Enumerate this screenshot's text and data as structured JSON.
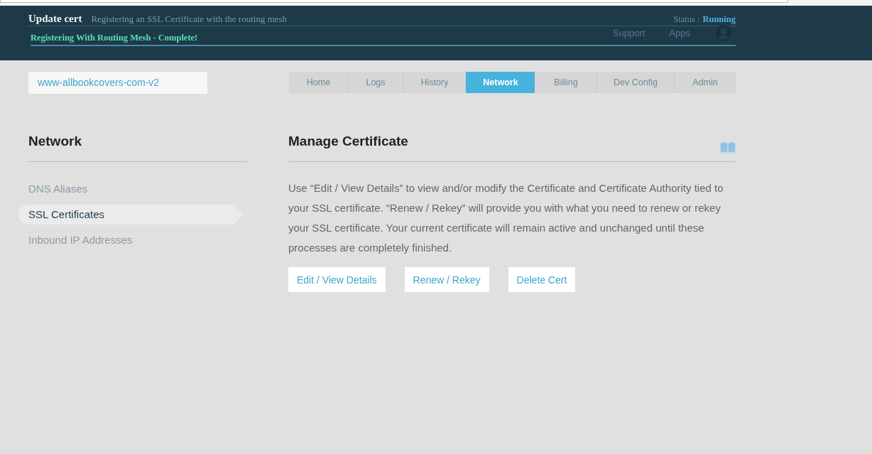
{
  "header": {
    "title": "Update cert",
    "subtitle": "Registering an SSL Certificate with the routing mesh",
    "status_label": "Status :",
    "status_value": "Running",
    "progress_message": "Registering With Routing Mesh - Complete!",
    "nav_links": [
      "Support",
      "Apps"
    ]
  },
  "app_name": "www-allbookcovers-com-v2",
  "tabs": [
    {
      "label": "Home",
      "selected": false
    },
    {
      "label": "Logs",
      "selected": false
    },
    {
      "label": "History",
      "selected": false
    },
    {
      "label": "Network",
      "selected": true
    },
    {
      "label": "Billing",
      "selected": false
    },
    {
      "label": "Dev Config",
      "selected": false
    },
    {
      "label": "Admin",
      "selected": false
    }
  ],
  "sidebar": {
    "title": "Network",
    "items": [
      {
        "label": "DNS Aliases",
        "selected": false
      },
      {
        "label": "SSL Certificates",
        "selected": true
      },
      {
        "label": "Inbound IP Addresses",
        "selected": false
      }
    ]
  },
  "main": {
    "title": "Manage Certificate",
    "description": "Use “Edit / View Details” to view and/or modify the Certificate and Certificate Authority tied to your SSL certificate. “Renew / Rekey” will provide you with what you need to renew or rekey your SSL certificate. Your current certificate will remain active and unchanged until these processes are completely finished.",
    "buttons": [
      "Edit / View Details",
      "Renew / Rekey",
      "Delete Cert"
    ]
  }
}
